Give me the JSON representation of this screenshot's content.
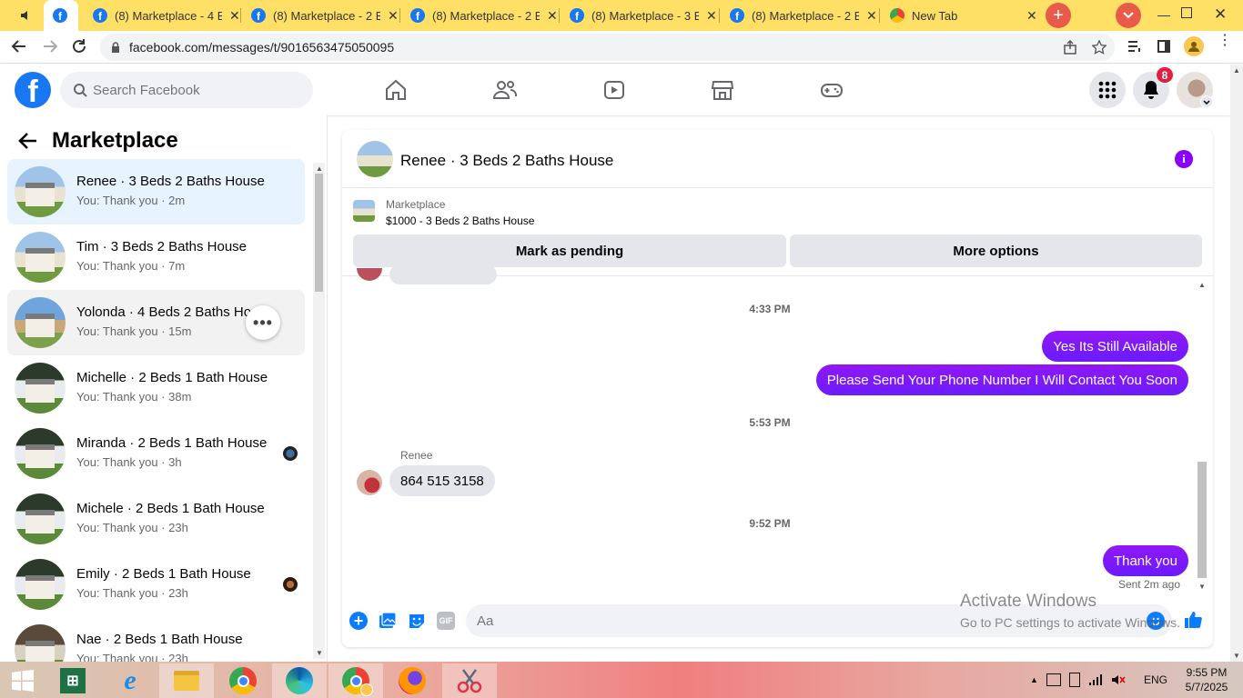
{
  "browser": {
    "tabs": [
      {
        "title": "(8) Marketplace - 4 B",
        "active": false
      },
      {
        "title": "(8) Marketplace - 2 B",
        "active": false
      },
      {
        "title": "(8) Marketplace - 2 B",
        "active": false
      },
      {
        "title": "(8) Marketplace - 3 B",
        "active": false
      },
      {
        "title": "(8) Marketplace - 2 B",
        "active": false
      },
      {
        "title": "New Tab",
        "active": false
      }
    ],
    "url": "facebook.com/messages/t/9016563475050095"
  },
  "fb": {
    "logo_letter": "f",
    "search_placeholder": "Search Facebook",
    "notifications_count": "8"
  },
  "sidebar": {
    "title": "Marketplace",
    "conversations": [
      {
        "name": "Renee · 3 Beds 2 Baths House",
        "sub": "You: Thank you · 2m"
      },
      {
        "name": "Tim · 3 Beds 2 Baths House",
        "sub": "You: Thank you · 7m"
      },
      {
        "name": "Yolonda · 4 Beds 2 Baths House",
        "sub": "You: Thank you · 15m"
      },
      {
        "name": "Michelle · 2 Beds 1 Bath House",
        "sub": "You: Thank you · 38m"
      },
      {
        "name": "Miranda · 2 Beds 1 Bath House",
        "sub": "You: Thank you · 3h"
      },
      {
        "name": "Michele · 2 Beds 1 Bath House",
        "sub": "You: Thank you · 23h"
      },
      {
        "name": "Emily · 2 Beds 1 Bath House",
        "sub": "You: Thank you · 23h"
      },
      {
        "name": "Nae · 2 Beds 1 Bath House",
        "sub": "You: Thank you · 23h"
      }
    ]
  },
  "chat": {
    "title": "Renee · 3 Beds 2 Baths House",
    "listing": {
      "source": "Marketplace",
      "price_title": "$1000 - 3 Beds 2 Baths House",
      "mark_pending": "Mark as pending",
      "more_options": "More options"
    },
    "timestamps": [
      "4:33 PM",
      "5:53 PM",
      "9:52 PM"
    ],
    "messages": {
      "out1": "Yes Its Still Available",
      "out2": "Please Send Your Phone Number I Will Contact You Soon",
      "in_sender": "Renee",
      "in1": "864 515 3158",
      "out3": "Thank you",
      "sent_status": "Sent 2m ago"
    },
    "composer_placeholder": "Aa"
  },
  "windows": {
    "activate_title": "Activate Windows",
    "activate_sub": "Go to PC settings to activate Windows.",
    "lang": "ENG",
    "time": "9:55 PM",
    "date": "5/7/2025"
  }
}
